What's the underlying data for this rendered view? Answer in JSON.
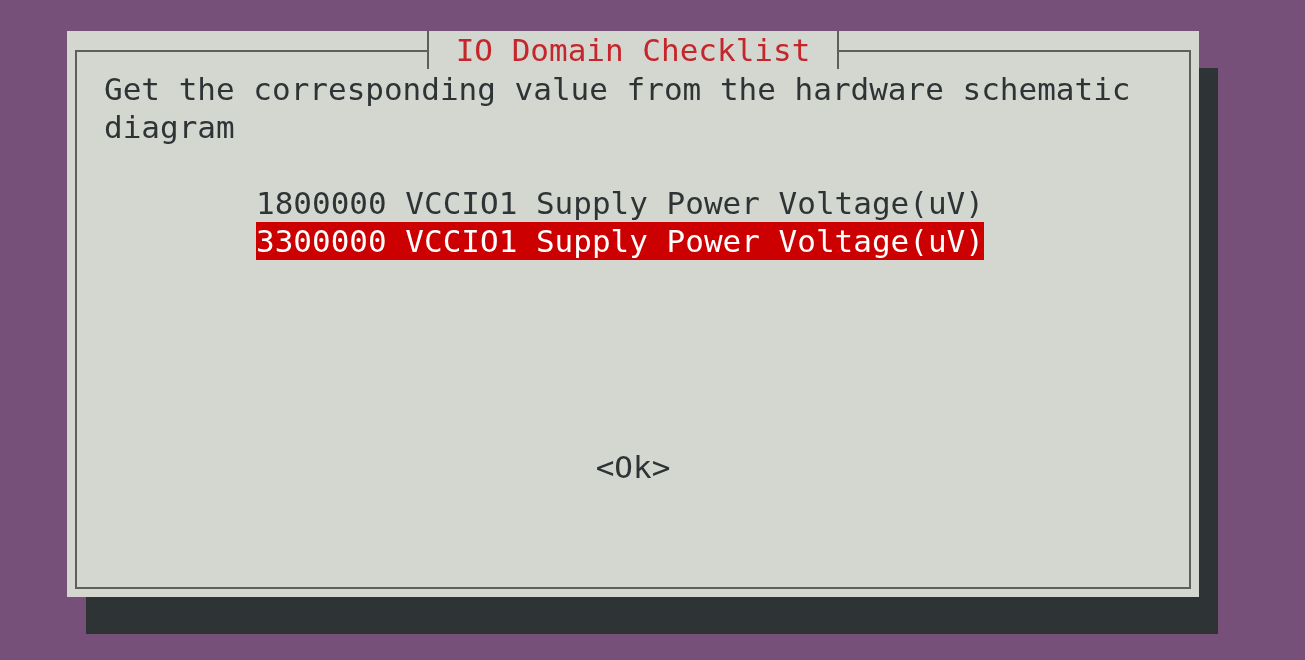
{
  "dialog": {
    "title": "IO Domain Checklist",
    "message": "Get the corresponding value from the hardware schematic diagram",
    "items": [
      {
        "label": "1800000 VCCIO1 Supply Power Voltage(uV)",
        "selected": false
      },
      {
        "label": "3300000 VCCIO1 Supply Power Voltage(uV)",
        "selected": true
      }
    ],
    "button": "<Ok>"
  }
}
